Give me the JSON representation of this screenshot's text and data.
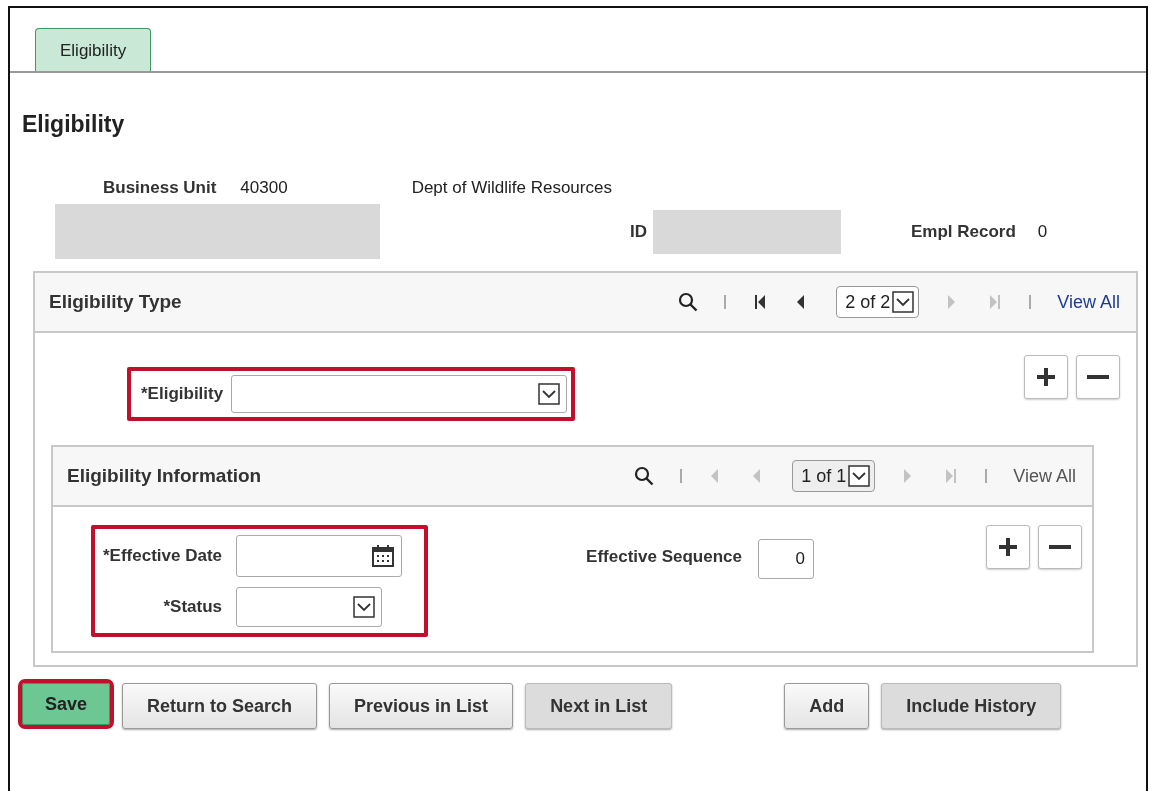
{
  "tabs": [
    {
      "label": "Eligibility",
      "selected": true
    }
  ],
  "page_title": "Eligibility",
  "header": {
    "business_unit_label": "Business Unit",
    "business_unit": "40300",
    "department": "Dept of Wildlife Resources",
    "id_label": "ID",
    "empl_record_label": "Empl Record",
    "empl_record": "0"
  },
  "eligibility_type": {
    "title": "Eligibility Type",
    "counter": "2 of 2",
    "view_all": "View All",
    "view_all_link": true,
    "nav": [
      {
        "kind": "first",
        "disabled": false
      },
      {
        "kind": "prev",
        "disabled": false
      },
      {
        "kind": "next",
        "disabled": true
      },
      {
        "kind": "last",
        "disabled": true
      }
    ],
    "field_label": "*Eligibility",
    "field_highlighted": true,
    "eligibility_information": {
      "title": "Eligibility Information",
      "counter": "1 of 1",
      "view_all": "View All",
      "view_all_link": false,
      "nav": [
        {
          "kind": "prev",
          "disabled": true
        },
        {
          "kind": "prev",
          "disabled": true
        },
        {
          "kind": "next",
          "disabled": true
        },
        {
          "kind": "last",
          "disabled": true
        }
      ],
      "effective_date_label": "*Effective Date",
      "status_label": "*Status",
      "fields_highlighted": true,
      "sequence_label": "Effective Sequence",
      "sequence_value": "0"
    }
  },
  "buttons": [
    {
      "label": "Save",
      "kind": "primary",
      "highlighted": true,
      "disabled": false
    },
    {
      "label": "Return to Search",
      "kind": "normal",
      "highlighted": false,
      "disabled": false
    },
    {
      "label": "Previous in List",
      "kind": "normal",
      "highlighted": false,
      "disabled": false
    },
    {
      "label": "Next in List",
      "kind": "normal",
      "highlighted": false,
      "disabled": true
    },
    {
      "label": "Add",
      "kind": "normal",
      "highlighted": false,
      "disabled": false
    },
    {
      "label": "Include History",
      "kind": "normal",
      "highlighted": false,
      "disabled": true
    }
  ]
}
